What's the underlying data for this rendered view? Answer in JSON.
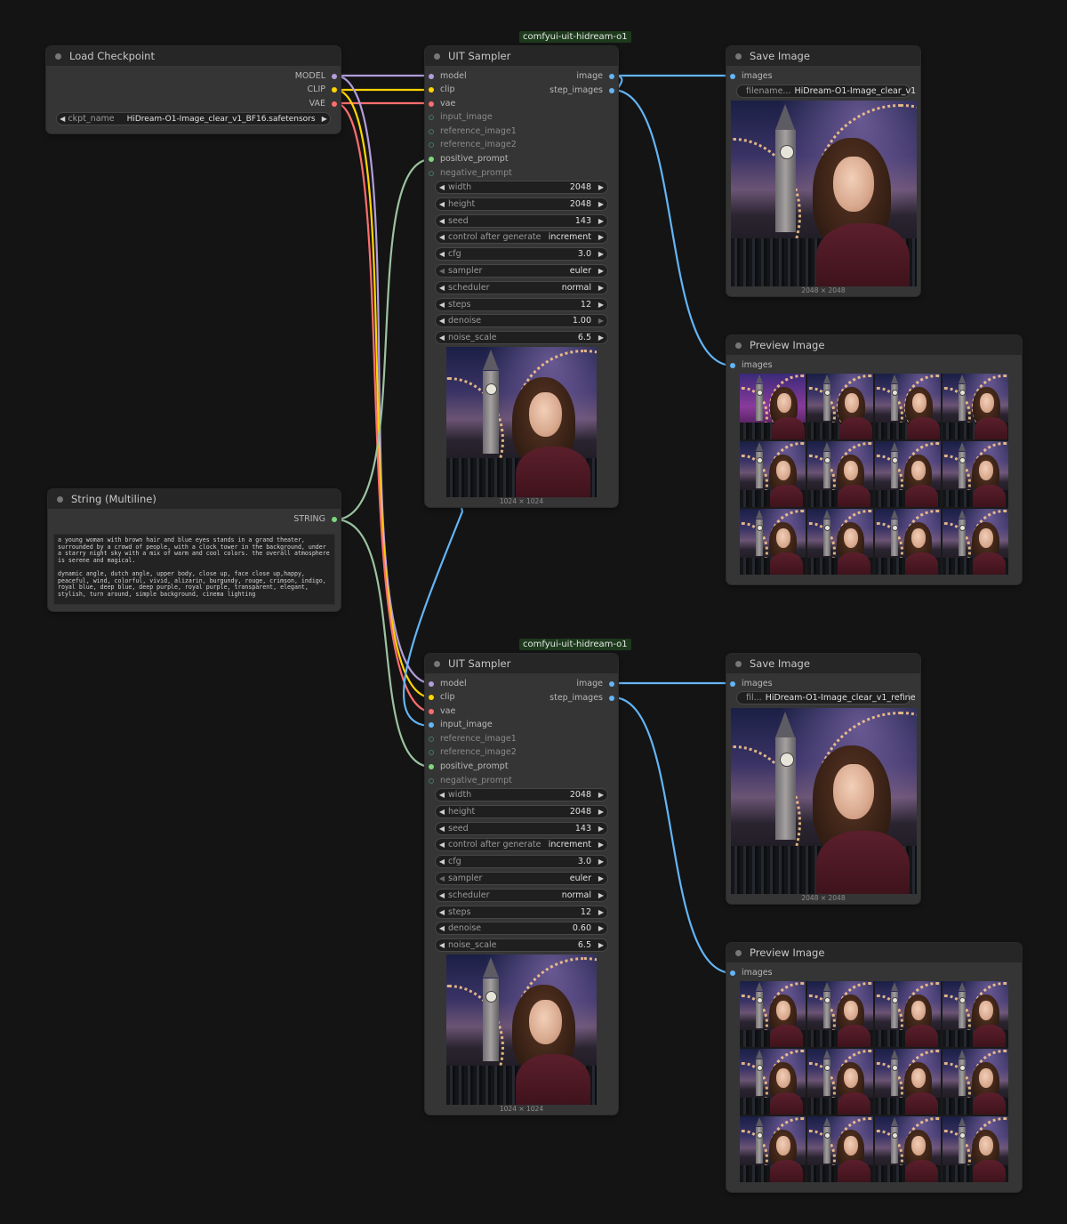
{
  "load_checkpoint": {
    "title": "Load Checkpoint",
    "outputs": [
      "MODEL",
      "CLIP",
      "VAE"
    ],
    "ckpt_label": "ckpt_name",
    "ckpt_value": "HiDream-O1-Image_clear_v1_BF16.safetensors"
  },
  "string_node": {
    "title": "String (Multiline)",
    "output": "STRING",
    "text": "a young woman with brown hair and blue eyes stands in a grand theater, surrounded by a crowd of people, with a clock tower in the background, under a starry night sky with a mix of warm and cool colors. the overall atmosphere is serene and magical.\n\ndynamic angle, dutch angle, upper body, close up, face close up,happy, peaceful, wind, colorful, vivid, alizarin, burgundy, rouge, crimson, indigo, royal blue, deep blue, deep purple, royal purple, transparent, elegant, stylish, turn around, simple background, cinema lighting"
  },
  "sampler1": {
    "badge": "comfyui-uit-hidream-o1",
    "title": "UIT Sampler",
    "inputs": [
      "model",
      "clip",
      "vae",
      "input_image",
      "reference_image1",
      "reference_image2",
      "positive_prompt",
      "negative_prompt"
    ],
    "outputs": [
      "image",
      "step_images"
    ],
    "widgets": [
      {
        "label": "width",
        "value": "2048"
      },
      {
        "label": "height",
        "value": "2048"
      },
      {
        "label": "seed",
        "value": "143"
      },
      {
        "label": "control after generate",
        "value": "increment"
      },
      {
        "label": "cfg",
        "value": "3.0"
      },
      {
        "label": "sampler",
        "value": "euler"
      },
      {
        "label": "scheduler",
        "value": "normal"
      },
      {
        "label": "steps",
        "value": "12"
      },
      {
        "label": "denoise",
        "value": "1.00"
      },
      {
        "label": "noise_scale",
        "value": "6.5"
      }
    ],
    "preview_size": "1024 × 1024"
  },
  "sampler2": {
    "badge": "comfyui-uit-hidream-o1",
    "title": "UIT Sampler",
    "inputs": [
      "model",
      "clip",
      "vae",
      "input_image",
      "reference_image1",
      "reference_image2",
      "positive_prompt",
      "negative_prompt"
    ],
    "outputs": [
      "image",
      "step_images"
    ],
    "widgets": [
      {
        "label": "width",
        "value": "2048"
      },
      {
        "label": "height",
        "value": "2048"
      },
      {
        "label": "seed",
        "value": "143"
      },
      {
        "label": "control after generate",
        "value": "increment"
      },
      {
        "label": "cfg",
        "value": "3.0"
      },
      {
        "label": "sampler",
        "value": "euler"
      },
      {
        "label": "scheduler",
        "value": "normal"
      },
      {
        "label": "steps",
        "value": "12"
      },
      {
        "label": "denoise",
        "value": "0.60"
      },
      {
        "label": "noise_scale",
        "value": "6.5"
      }
    ],
    "preview_size": "1024 × 1024"
  },
  "save1": {
    "title": "Save Image",
    "input": "images",
    "filename_label": "filename...",
    "filename_value": "HiDream-O1-Image_clear_v1",
    "image_size": "2048 × 2048"
  },
  "save2": {
    "title": "Save Image",
    "input": "images",
    "filename_label": "fil...",
    "filename_value": "HiDream-O1-Image_clear_v1_refine",
    "image_size": "2048 × 2048"
  },
  "preview1": {
    "title": "Preview Image",
    "input": "images"
  },
  "preview2": {
    "title": "Preview Image",
    "input": "images"
  },
  "colors": {
    "model": "#b39ddb",
    "clip": "#ffd500",
    "vae": "#ff6e6e",
    "image": "#64b5f6",
    "string": "#9cc3a0",
    "latent": "#ff9cf9"
  }
}
